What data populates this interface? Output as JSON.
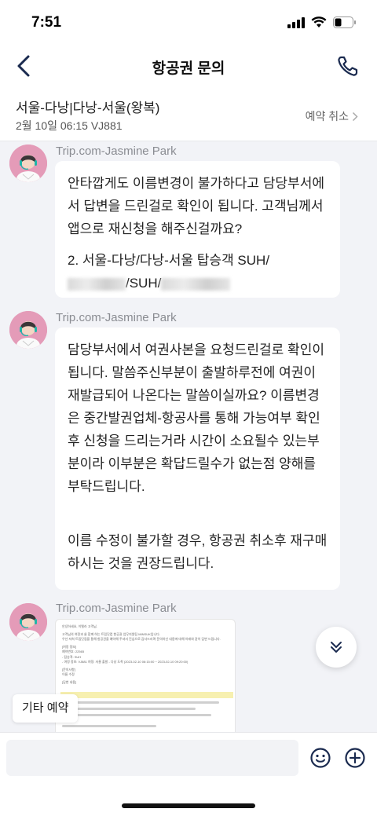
{
  "status_bar": {
    "time": "7:51"
  },
  "nav": {
    "title": "항공권 문의"
  },
  "trip": {
    "route": "서울-다낭|다낭-서울(왕복)",
    "date_flight": "2월 10일 06:15 VJ881",
    "cancel_label": "예약 취소"
  },
  "messages": [
    {
      "sender": "Trip.com-Jasmine Park",
      "paragraphs": [
        "안타깝게도 이름변경이 불가하다고 담당부서에서 답변을 드린걸로 확인이 됩니다. 고객님께서 앱으로 재신청을 해주신걸까요?"
      ],
      "line2_prefix": "2. 서울-다낭/다낭-서울 탑승객 SUH/",
      "line2_suffix": "/SUH/"
    },
    {
      "sender": "Trip.com-Jasmine Park",
      "paragraphs": [
        "담당부서에서 여권사본을 요청드린걸로 확인이 됩니다. 말씀주신부분이 출발하루전에 여권이 재발급되어 나온다는 말씀이실까요? 이름변경은 중간발권업체-항공사를 통해 가능여부 확인후 신청을 드리는거라 시간이 소요될수 있는부분이라 이부분은 확답드릴수가 없는점 양해를 부탁드립니다.",
        "이름 수정이 불가할 경우, 항공권 취소후 재구매하시는 것을 권장드립니다."
      ]
    },
    {
      "sender": "Trip.com-Jasmine Park",
      "image_lines": [
        "안녕하세요, 이멜라 고객님.",
        "고객님의 여정과 쓸 함께 하는 트립닷컴 항공권 업무지원팀 MINSUK입니다.",
        "우선 저희 트립닷컴을 통해 항공권을 예약해 주셔서 진심으로 감사드리며 문의하신 내용에 대해 아래와 같이 답변 드립니다.",
        "[여정 정보]",
        "예약번호: 22565",
        "- 탑승객: SUH",
        "- 여정 정보: VJ881 여정: 서울 출발 - 다낭 도착 (2023-02-10 06:15:00 ~ 2023-02-10 09:20:00)",
        "[문의사항]",
        "이름 수정",
        "[답변 내용]"
      ]
    }
  ],
  "other_booking_label": "기타 예약",
  "input": {
    "placeholder": ""
  },
  "colors": {
    "accent": "#1a2a4f",
    "bubble": "#ffffff",
    "background": "#f2f3f7"
  }
}
